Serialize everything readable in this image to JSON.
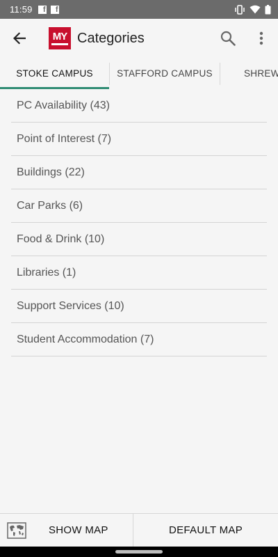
{
  "status_bar": {
    "time": "11:59",
    "notification_icons": [
      "facebook-icon",
      "facebook-icon"
    ],
    "system_icons": [
      "vibrate-icon",
      "wifi-icon",
      "battery-icon"
    ]
  },
  "app_bar": {
    "title": "Categories",
    "logo_text": "MY"
  },
  "tabs": [
    {
      "label": "STOKE CAMPUS",
      "selected": true
    },
    {
      "label": "STAFFORD CAMPUS",
      "selected": false
    },
    {
      "label": "SHREWS",
      "selected": false
    }
  ],
  "categories": [
    "PC Availability (43)",
    "Point of Interest (7)",
    "Buildings (22)",
    "Car Parks (6)",
    "Food & Drink (10)",
    "Libraries (1)",
    "Support Services (10)",
    "Student Accommodation (7)"
  ],
  "bottom_bar": {
    "show_map": "SHOW MAP",
    "default_map": "DEFAULT MAP"
  },
  "colors": {
    "accent": "#2e8b73",
    "logo": "#c8102e",
    "status_bar": "#6b6b6b"
  }
}
